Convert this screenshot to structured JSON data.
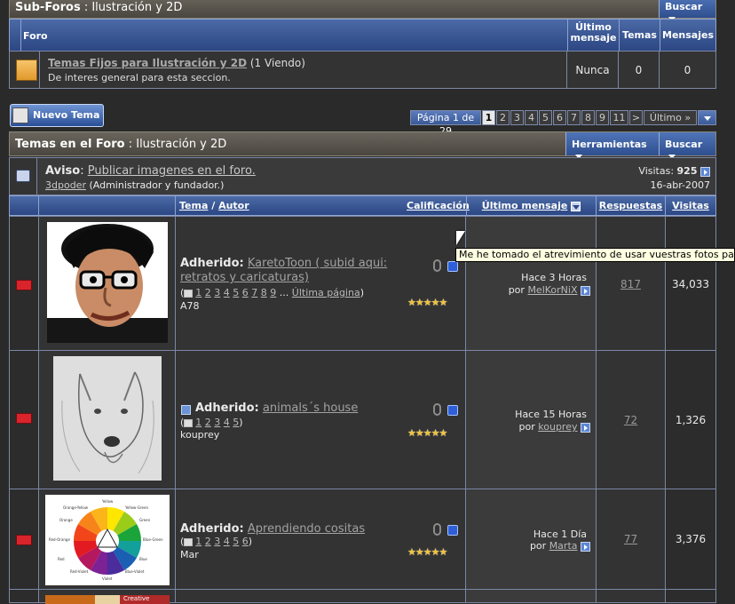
{
  "subforums_bar": {
    "title": "Sub-Foros",
    "sep": " : ",
    "forum": "Ilustración y 2D",
    "search": "Buscar"
  },
  "subforums_table": {
    "headers": {
      "forum": "Foro",
      "last_post": "Último\nmensaje",
      "threads": "Temas",
      "posts": "Mensajes"
    },
    "row": {
      "title": "Temas Fijos para Ilustración y 2D",
      "viewing": "(1 Viendo)",
      "desc": "De interes general para esta seccion.",
      "last_post": "Nunca",
      "threads": "0",
      "posts": "0"
    }
  },
  "new_thread_button": "Nuevo Tema",
  "pagination": {
    "page_label": "Página 1 de 29",
    "pages": [
      "1",
      "2",
      "3",
      "4",
      "5",
      "6",
      "7",
      "8",
      "9",
      "11"
    ],
    "next": ">",
    "last": "Último »"
  },
  "threads_bar": {
    "title": "Temas en el Foro",
    "sep": " : ",
    "forum": "Ilustración y 2D",
    "tools": "Herramientas",
    "search": "Buscar"
  },
  "notice": {
    "label": "Aviso",
    "colon": ":",
    "title": "Publicar imagenes en el foro.",
    "author": "3dpoder",
    "author_role": "(Administrador y fundador.)",
    "visits_label": "Visitas:",
    "visits": "925",
    "date": "16-abr-2007"
  },
  "thread_headers": {
    "topic": "Tema",
    "slash": " / ",
    "author": "Autor",
    "rating": "Calificación",
    "last_post": "Último mensaje",
    "replies": "Respuestas",
    "views": "Visitas"
  },
  "tooltip": "Me he tomado el atrevimiento de usar vuestras fotos para practic",
  "threads": [
    {
      "prefix": "Adherido:",
      "title": "KaretoToon ( subid aqui: retratos y caricaturas)",
      "pages": [
        "1",
        "2",
        "3",
        "4",
        "5",
        "6",
        "7",
        "8",
        "9"
      ],
      "ellipsis": "...",
      "last_page": "Última página",
      "author": "A78",
      "last_time": "Hace 3 Horas",
      "by": "por",
      "last_user": "MelKorNiX",
      "replies": "817",
      "views": "34,033",
      "stars": "★★★★★"
    },
    {
      "prefix": "Adherido:",
      "title": "animals´s house",
      "pages": [
        "1",
        "2",
        "3",
        "4",
        "5"
      ],
      "author": "kouprey",
      "last_time": "Hace 15 Horas",
      "by": "por",
      "last_user": "kouprey",
      "replies": "72",
      "views": "1,326",
      "stars": "★★★★★"
    },
    {
      "prefix": "Adherido:",
      "title": "Aprendiendo cositas",
      "pages": [
        "1",
        "2",
        "3",
        "4",
        "5",
        "6"
      ],
      "author": "Mar",
      "last_time": "Hace 1 Día",
      "by": "por",
      "last_user": "Marta",
      "replies": "77",
      "views": "3,376",
      "stars": "★★★★★"
    }
  ],
  "color_wheel_labels": [
    "Yellow",
    "Yellow-Green",
    "Green",
    "Blue-Green",
    "Blue",
    "Blue-Violet",
    "Violet",
    "Red-Violet",
    "Red",
    "Red-Orange",
    "Orange",
    "Orange-Yellow"
  ],
  "partial_thumb_text": "Creative"
}
